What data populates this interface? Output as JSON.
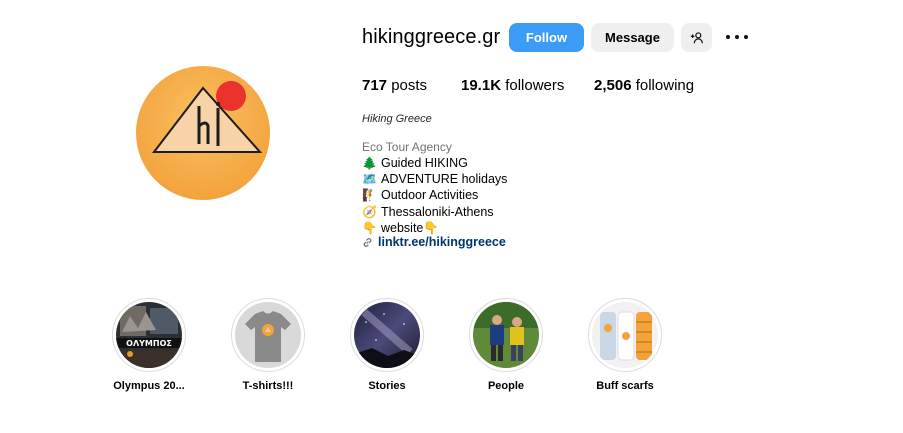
{
  "profile": {
    "username": "hikinggreece.gr",
    "full_name": "Hiking Greece",
    "category": "Eco Tour Agency",
    "avatar_icon": "hiking-greece-logo"
  },
  "actions": {
    "follow_label": "Follow",
    "message_label": "Message",
    "add_user_icon": "add-person-icon",
    "more_icon": "more-options-icon"
  },
  "stats": {
    "posts_count": "717",
    "posts_label": "posts",
    "followers_count": "19.1K",
    "followers_label": "followers",
    "following_count": "2,506",
    "following_label": "following"
  },
  "bio": {
    "lines": [
      {
        "emoji": "🌲",
        "text": "Guided HIKING"
      },
      {
        "emoji": "🗺️",
        "text": "ADVENTURE holidays"
      },
      {
        "emoji": "🧗",
        "text": "Outdoor Activities"
      },
      {
        "emoji": "🧭",
        "text": "Thessaloniki-Athens"
      },
      {
        "emoji": "👇",
        "text": "website👇"
      }
    ],
    "link_text": "linktr.ee/hikinggreece",
    "link_icon": "link-icon"
  },
  "highlights": [
    {
      "label": "Olympus 20...",
      "cover": "olympus-cover"
    },
    {
      "label": "T-shirts!!!",
      "cover": "tshirt-cover"
    },
    {
      "label": "Stories",
      "cover": "night-sky-cover"
    },
    {
      "label": "People",
      "cover": "people-cover"
    },
    {
      "label": "Buff scarfs",
      "cover": "buff-scarfs-cover"
    }
  ],
  "colors": {
    "follow_button": "#3b9cf5",
    "secondary_button": "#efefef",
    "link": "#00376b",
    "avatar_orange": "#f3a33c",
    "avatar_sun": "#e8322b"
  }
}
